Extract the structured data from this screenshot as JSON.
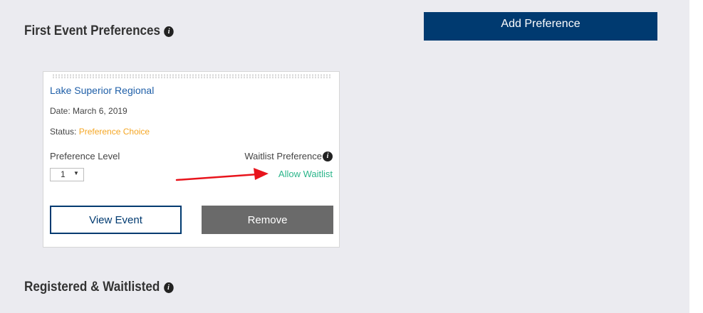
{
  "first_section": {
    "title": "First Event Preferences",
    "info_icon": "info-icon"
  },
  "add_preference_button": {
    "label": "Add Preference"
  },
  "event_card": {
    "event_name": "Lake Superior Regional",
    "date_text": "Date: March 6, 2019",
    "status_label": "Status:",
    "status_value": "Preference Choice",
    "preference_level_label": "Preference Level",
    "preference_level_value": "1",
    "waitlist_preference_label": "Waitlist Preference",
    "allow_waitlist_label": "Allow Waitlist",
    "view_event_label": "View Event",
    "remove_label": "Remove"
  },
  "second_section": {
    "title": "Registered & Waitlisted",
    "info_icon": "info-icon"
  },
  "colors": {
    "panel_background": "#ebebf0",
    "primary_navy": "#003a70",
    "link_blue": "#1f5fa8",
    "status_orange": "#f5a623",
    "waitlist_green": "#2bb58a",
    "remove_gray": "#6a6a6a",
    "annotation_red": "#e8141c"
  }
}
